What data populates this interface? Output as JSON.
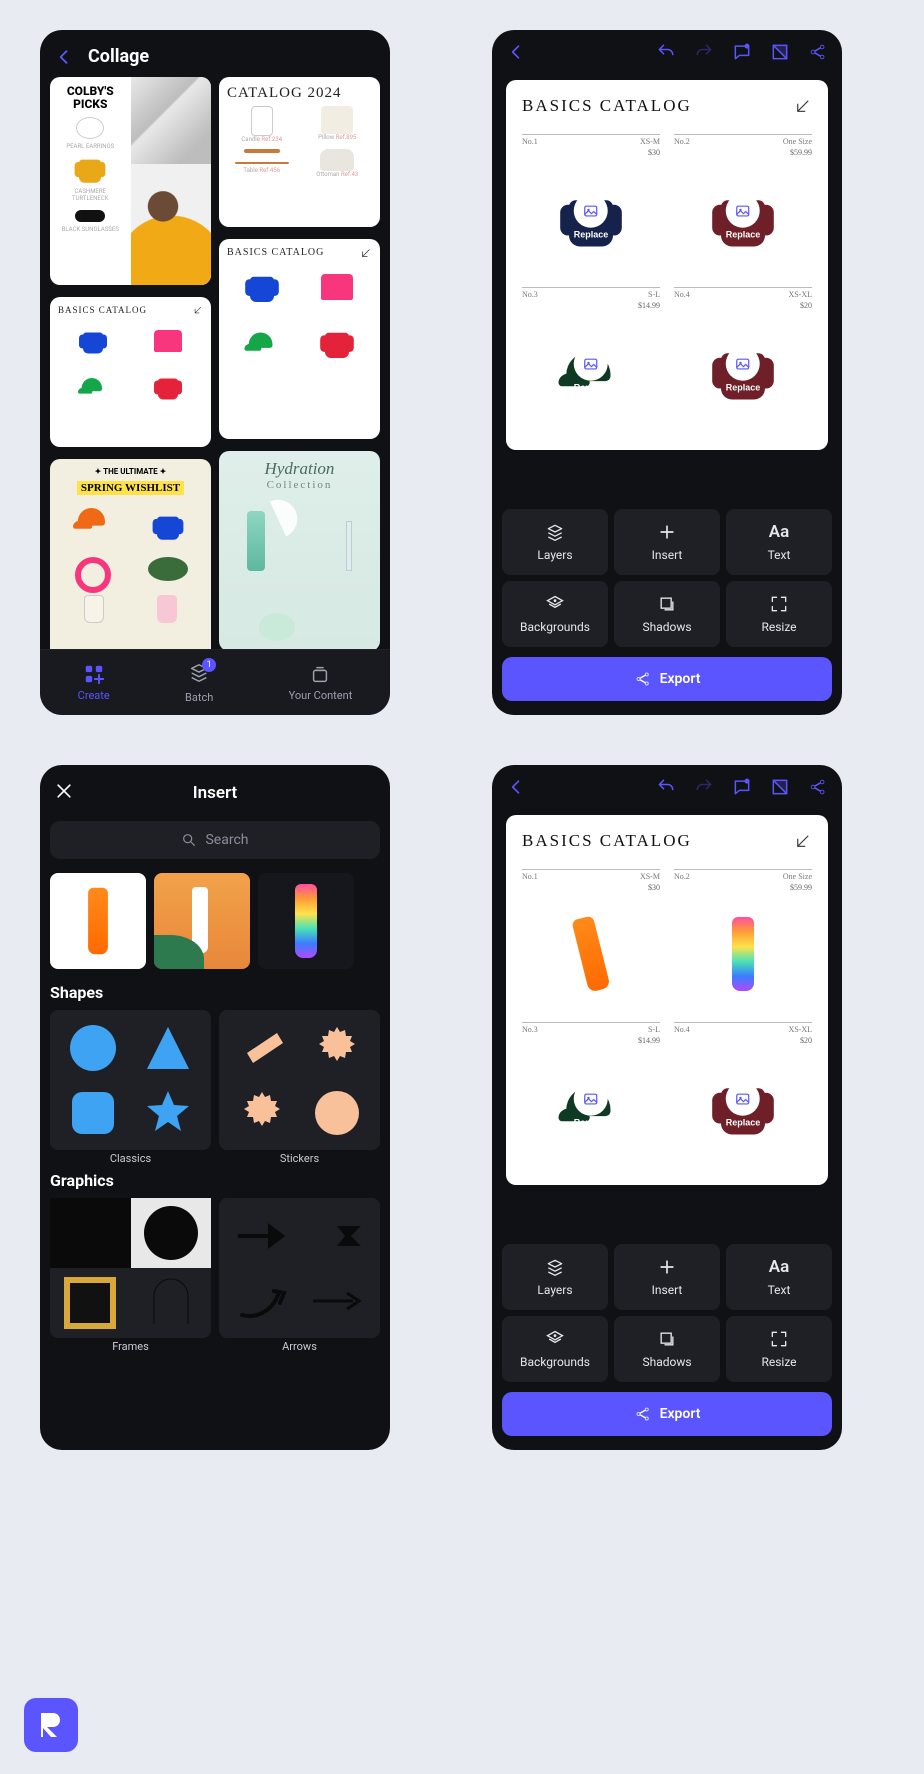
{
  "screen1": {
    "title": "Collage",
    "tiles": {
      "colby": {
        "title": "COLBY'S PICKS",
        "items": [
          "PEARL EARRINGS",
          "CASHMERE TURTLENECK",
          "BLACK SUNGLASSES"
        ]
      },
      "catalog2024": {
        "title": "CATALOG 2024",
        "items": [
          {
            "name": "Candle",
            "meta": "Ref.234"
          },
          {
            "name": "Pillow",
            "meta": "Ref.895"
          },
          {
            "name": "Table",
            "meta": "Ref.456"
          },
          {
            "name": "Ottoman",
            "meta": "Ref.43"
          }
        ]
      },
      "basics_small": {
        "title": "BASICS CATALOG"
      },
      "basics_mid": {
        "title": "BASICS CATALOG"
      },
      "spring": {
        "line1": "THE ULTIMATE",
        "line2": "SPRING",
        "line3": "WISHLIST"
      },
      "hydration": {
        "line1": "Hydration",
        "line2": "Collection"
      }
    },
    "bottom_nav": {
      "create": "Create",
      "batch": "Batch",
      "batch_badge": "1",
      "your_content": "Your Content"
    }
  },
  "editor": {
    "canvas_title": "BASICS CATALOG",
    "cells": [
      {
        "no": "No.1",
        "size": "XS-M",
        "price": "$30"
      },
      {
        "no": "No.2",
        "size": "One Size",
        "price": "$59.99"
      },
      {
        "no": "No.3",
        "size": "S-L",
        "price": "$14.99"
      },
      {
        "no": "No.4",
        "size": "XS-XL",
        "price": "$20"
      }
    ],
    "replace_label": "Replace",
    "actions": {
      "layers": "Layers",
      "insert": "Insert",
      "text": "Text",
      "text_icon": "Aa",
      "backgrounds": "Backgrounds",
      "shadows": "Shadows",
      "resize": "Resize"
    },
    "export": "Export"
  },
  "screen3": {
    "title": "Insert",
    "search_placeholder": "Search",
    "shapes_h": "Shapes",
    "classics": "Classics",
    "stickers": "Stickers",
    "graphics_h": "Graphics",
    "frames": "Frames",
    "arrows": "Arrows"
  },
  "colors": {
    "accent": "#5A55FF"
  }
}
